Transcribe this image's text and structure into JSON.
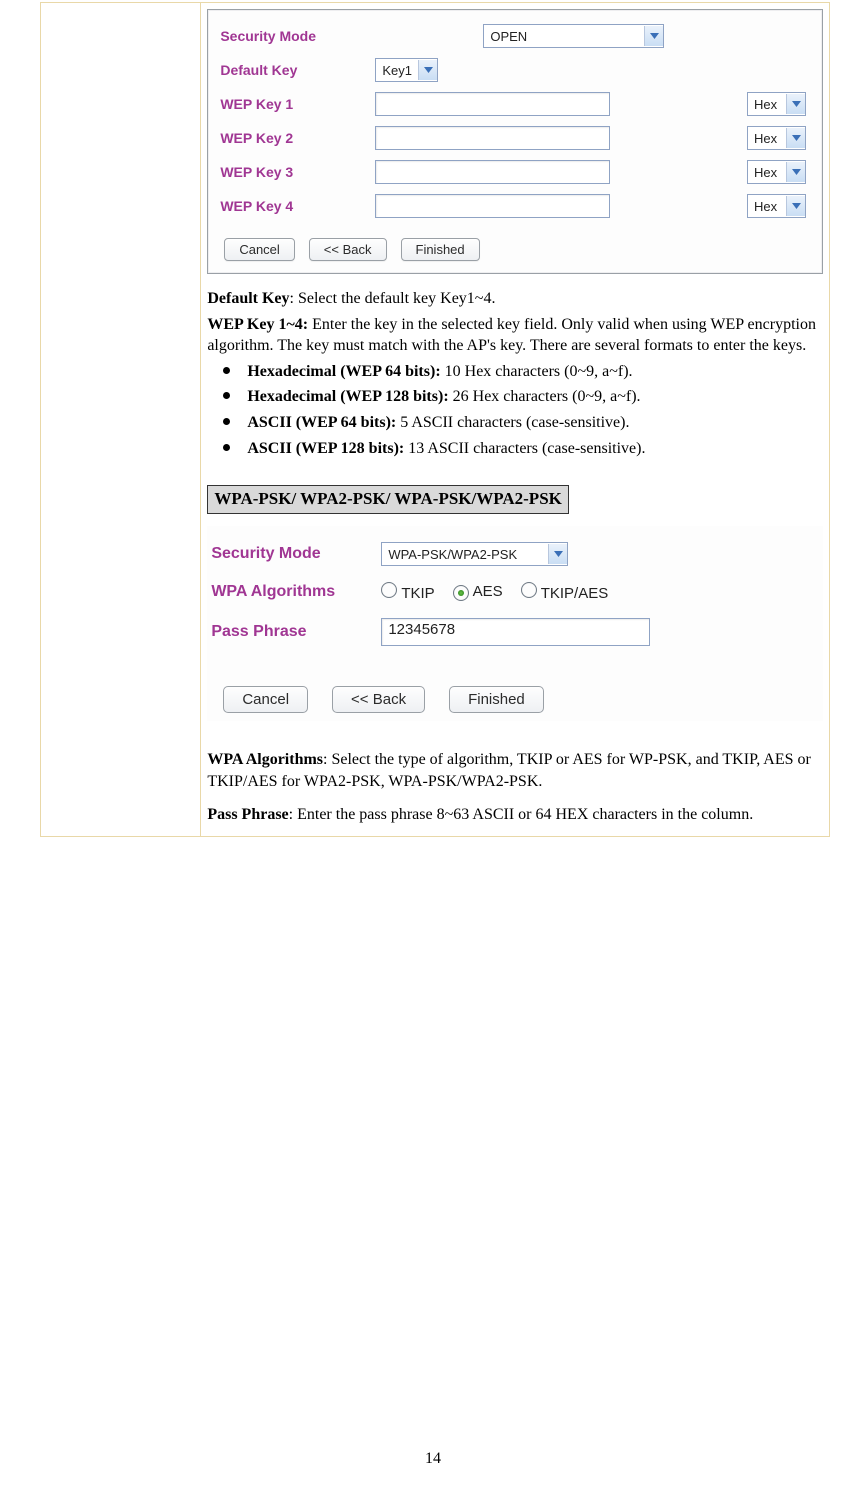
{
  "page_number": "14",
  "panel1": {
    "label_security_mode": "Security Mode",
    "value_security_mode": "OPEN",
    "label_default_key": "Default Key",
    "value_default_key": "Key1",
    "label_wep1": "WEP Key 1",
    "label_wep2": "WEP Key 2",
    "label_wep3": "WEP Key 3",
    "label_wep4": "WEP Key 4",
    "hex_value": "Hex",
    "btn_cancel": "Cancel",
    "btn_back": "<<  Back",
    "btn_finished": "Finished"
  },
  "explain1": {
    "default_key_bold": "Default Key",
    "default_key_rest": ": Select the default key Key1~4.",
    "wep_key_bold": "WEP Key 1~4:",
    "wep_key_rest": " Enter the key in the selected key field. Only valid when using WEP encryption algorithm. The key must match with the AP's key. There are several formats to enter the keys.",
    "li1_bold": "Hexadecimal (WEP 64 bits):",
    "li1_rest": " 10 Hex characters (0~9, a~f).",
    "li2_bold": "Hexadecimal (WEP 128 bits):",
    "li2_rest": " 26 Hex characters (0~9, a~f).",
    "li3_bold": "ASCII (WEP 64 bits):",
    "li3_rest": " 5 ASCII characters (case-sensitive).",
    "li4_bold": "ASCII (WEP 128 bits):",
    "li4_rest": " 13 ASCII characters (case-sensitive)."
  },
  "section_heading": "WPA-PSK/ WPA2-PSK/ WPA-PSK/WPA2-PSK",
  "panel2": {
    "label_security_mode": "Security Mode",
    "value_security_mode": "WPA-PSK/WPA2-PSK",
    "label_algorithms": "WPA Algorithms",
    "opt_tkip": "TKIP",
    "opt_aes": "AES",
    "opt_tkipaes": "TKIP/AES",
    "label_passphrase": "Pass Phrase",
    "value_passphrase": "12345678",
    "btn_cancel": "Cancel",
    "btn_back": "<<  Back",
    "btn_finished": "Finished"
  },
  "explain2": {
    "wpa_bold": "WPA Algorithms",
    "wpa_rest": ": Select the type of algorithm, TKIP or AES for WP-PSK, and TKIP, AES or TKIP/AES for WPA2-PSK, WPA-PSK/WPA2-PSK.",
    "pass_bold": "Pass Phrase",
    "pass_rest": ": Enter the pass phrase 8~63 ASCII or 64 HEX characters in the column."
  }
}
